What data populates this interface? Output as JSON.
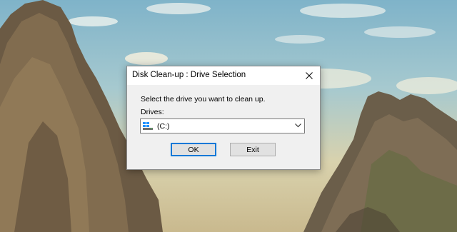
{
  "dialog": {
    "title": "Disk Clean-up : Drive Selection",
    "prompt": "Select the drive you want to clean up.",
    "drives_label": "Drives:",
    "selected_drive": "(C:)",
    "ok_label": "OK",
    "exit_label": "Exit",
    "icons": {
      "close": "close-icon",
      "drive": "hard-drive-icon",
      "dropdown": "chevron-down-icon"
    }
  },
  "colors": {
    "focus_border": "#0078d7",
    "dialog_bg": "#f0f0f0"
  }
}
